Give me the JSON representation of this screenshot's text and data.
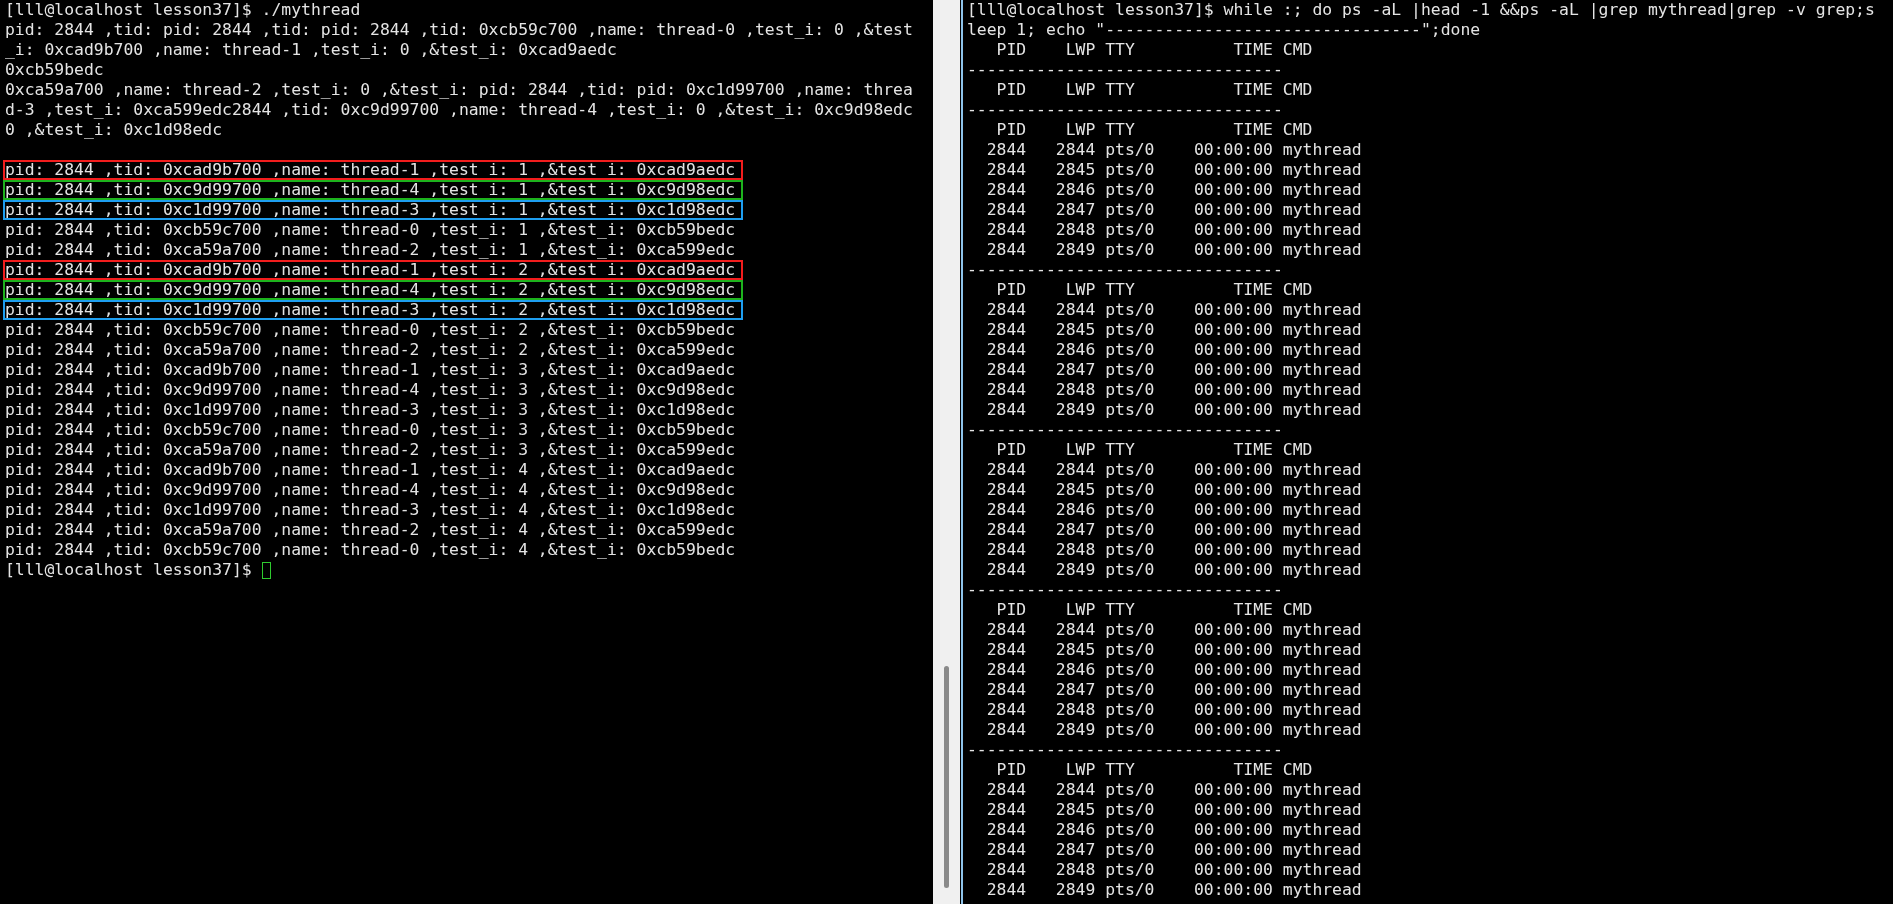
{
  "left_terminal": {
    "blocks": [
      {
        "lines": [
          {
            "text": "[lll@localhost lesson37]$ ./mythread"
          },
          {
            "text": "pid: 2844 ,tid: pid: 2844 ,tid: pid: 2844 ,tid: 0xcb59c700 ,name: thread-0 ,test_i: 0 ,&test"
          },
          {
            "text": "_i: 0xcad9b700 ,name: thread-1 ,test_i: 0 ,&test_i: 0xcad9aedc"
          },
          {
            "text": "0xcb59bedc"
          },
          {
            "text": "0xca59a700 ,name: thread-2 ,test_i: 0 ,&test_i: pid: 2844 ,tid: pid: 0xc1d99700 ,name: threa"
          },
          {
            "text": "d-3 ,test_i: 0xca599edc2844 ,tid: 0xc9d99700 ,name: thread-4 ,test_i: 0 ,&test_i: 0xc9d98edc"
          },
          {
            "text": "0 ,&test_i: 0xc1d98edc"
          }
        ]
      },
      {
        "lines": [
          {
            "text": "pid: 2844 ,tid: 0xcad9b700 ,name: thread-1 ,test_i: 1 ,&test_i: 0xcad9aedc",
            "color": "#f21d1d"
          },
          {
            "text": "pid: 2844 ,tid: 0xc9d99700 ,name: thread-4 ,test_i: 1 ,&test_i: 0xc9d98edc",
            "color": "#1db31d"
          },
          {
            "text": "pid: 2844 ,tid: 0xc1d99700 ,name: thread-3 ,test_i: 1 ,&test_i: 0xc1d98edc",
            "color": "#1e9ef0"
          },
          {
            "text": "pid: 2844 ,tid: 0xcb59c700 ,name: thread-0 ,test_i: 1 ,&test_i: 0xcb59bedc"
          },
          {
            "text": "pid: 2844 ,tid: 0xca59a700 ,name: thread-2 ,test_i: 1 ,&test_i: 0xca599edc"
          },
          {
            "text": "pid: 2844 ,tid: 0xcad9b700 ,name: thread-1 ,test_i: 2 ,&test_i: 0xcad9aedc",
            "color": "#f21d1d"
          },
          {
            "text": "pid: 2844 ,tid: 0xc9d99700 ,name: thread-4 ,test_i: 2 ,&test_i: 0xc9d98edc",
            "color": "#1db31d"
          },
          {
            "text": "pid: 2844 ,tid: 0xc1d99700 ,name: thread-3 ,test_i: 2 ,&test_i: 0xc1d98edc",
            "color": "#1e9ef0"
          },
          {
            "text": "pid: 2844 ,tid: 0xcb59c700 ,name: thread-0 ,test_i: 2 ,&test_i: 0xcb59bedc"
          },
          {
            "text": "pid: 2844 ,tid: 0xca59a700 ,name: thread-2 ,test_i: 2 ,&test_i: 0xca599edc"
          },
          {
            "text": "pid: 2844 ,tid: 0xcad9b700 ,name: thread-1 ,test_i: 3 ,&test_i: 0xcad9aedc"
          },
          {
            "text": "pid: 2844 ,tid: 0xc9d99700 ,name: thread-4 ,test_i: 3 ,&test_i: 0xc9d98edc"
          },
          {
            "text": "pid: 2844 ,tid: 0xc1d99700 ,name: thread-3 ,test_i: 3 ,&test_i: 0xc1d98edc"
          },
          {
            "text": "pid: 2844 ,tid: 0xcb59c700 ,name: thread-0 ,test_i: 3 ,&test_i: 0xcb59bedc"
          },
          {
            "text": "pid: 2844 ,tid: 0xca59a700 ,name: thread-2 ,test_i: 3 ,&test_i: 0xca599edc"
          },
          {
            "text": "pid: 2844 ,tid: 0xcad9b700 ,name: thread-1 ,test_i: 4 ,&test_i: 0xcad9aedc"
          },
          {
            "text": "pid: 2844 ,tid: 0xc9d99700 ,name: thread-4 ,test_i: 4 ,&test_i: 0xc9d98edc"
          },
          {
            "text": "pid: 2844 ,tid: 0xc1d99700 ,name: thread-3 ,test_i: 4 ,&test_i: 0xc1d98edc"
          },
          {
            "text": "pid: 2844 ,tid: 0xca59a700 ,name: thread-2 ,test_i: 4 ,&test_i: 0xca599edc"
          },
          {
            "text": "pid: 2844 ,tid: 0xcb59c700 ,name: thread-0 ,test_i: 4 ,&test_i: 0xcb59bedc"
          }
        ]
      }
    ],
    "prompt": "[lll@localhost lesson37]$ "
  },
  "right_terminal": {
    "lines": [
      "[lll@localhost lesson37]$ while :; do ps -aL |head -1 &&ps -aL |grep mythread|grep -v grep;s",
      "leep 1; echo \"--------------------------------\";done",
      "   PID    LWP TTY          TIME CMD",
      "--------------------------------",
      "   PID    LWP TTY          TIME CMD",
      "--------------------------------",
      "   PID    LWP TTY          TIME CMD",
      "  2844   2844 pts/0    00:00:00 mythread",
      "  2844   2845 pts/0    00:00:00 mythread",
      "  2844   2846 pts/0    00:00:00 mythread",
      "  2844   2847 pts/0    00:00:00 mythread",
      "  2844   2848 pts/0    00:00:00 mythread",
      "  2844   2849 pts/0    00:00:00 mythread",
      "--------------------------------",
      "   PID    LWP TTY          TIME CMD",
      "  2844   2844 pts/0    00:00:00 mythread",
      "  2844   2845 pts/0    00:00:00 mythread",
      "  2844   2846 pts/0    00:00:00 mythread",
      "  2844   2847 pts/0    00:00:00 mythread",
      "  2844   2848 pts/0    00:00:00 mythread",
      "  2844   2849 pts/0    00:00:00 mythread",
      "--------------------------------",
      "   PID    LWP TTY          TIME CMD",
      "  2844   2844 pts/0    00:00:00 mythread",
      "  2844   2845 pts/0    00:00:00 mythread",
      "  2844   2846 pts/0    00:00:00 mythread",
      "  2844   2847 pts/0    00:00:00 mythread",
      "  2844   2848 pts/0    00:00:00 mythread",
      "  2844   2849 pts/0    00:00:00 mythread",
      "--------------------------------",
      "   PID    LWP TTY          TIME CMD",
      "  2844   2844 pts/0    00:00:00 mythread",
      "  2844   2845 pts/0    00:00:00 mythread",
      "  2844   2846 pts/0    00:00:00 mythread",
      "  2844   2847 pts/0    00:00:00 mythread",
      "  2844   2848 pts/0    00:00:00 mythread",
      "  2844   2849 pts/0    00:00:00 mythread",
      "--------------------------------",
      "   PID    LWP TTY          TIME CMD",
      "  2844   2844 pts/0    00:00:00 mythread",
      "  2844   2845 pts/0    00:00:00 mythread",
      "  2844   2846 pts/0    00:00:00 mythread",
      "  2844   2847 pts/0    00:00:00 mythread",
      "  2844   2848 pts/0    00:00:00 mythread",
      "  2844   2849 pts/0    00:00:00 mythread"
    ]
  }
}
